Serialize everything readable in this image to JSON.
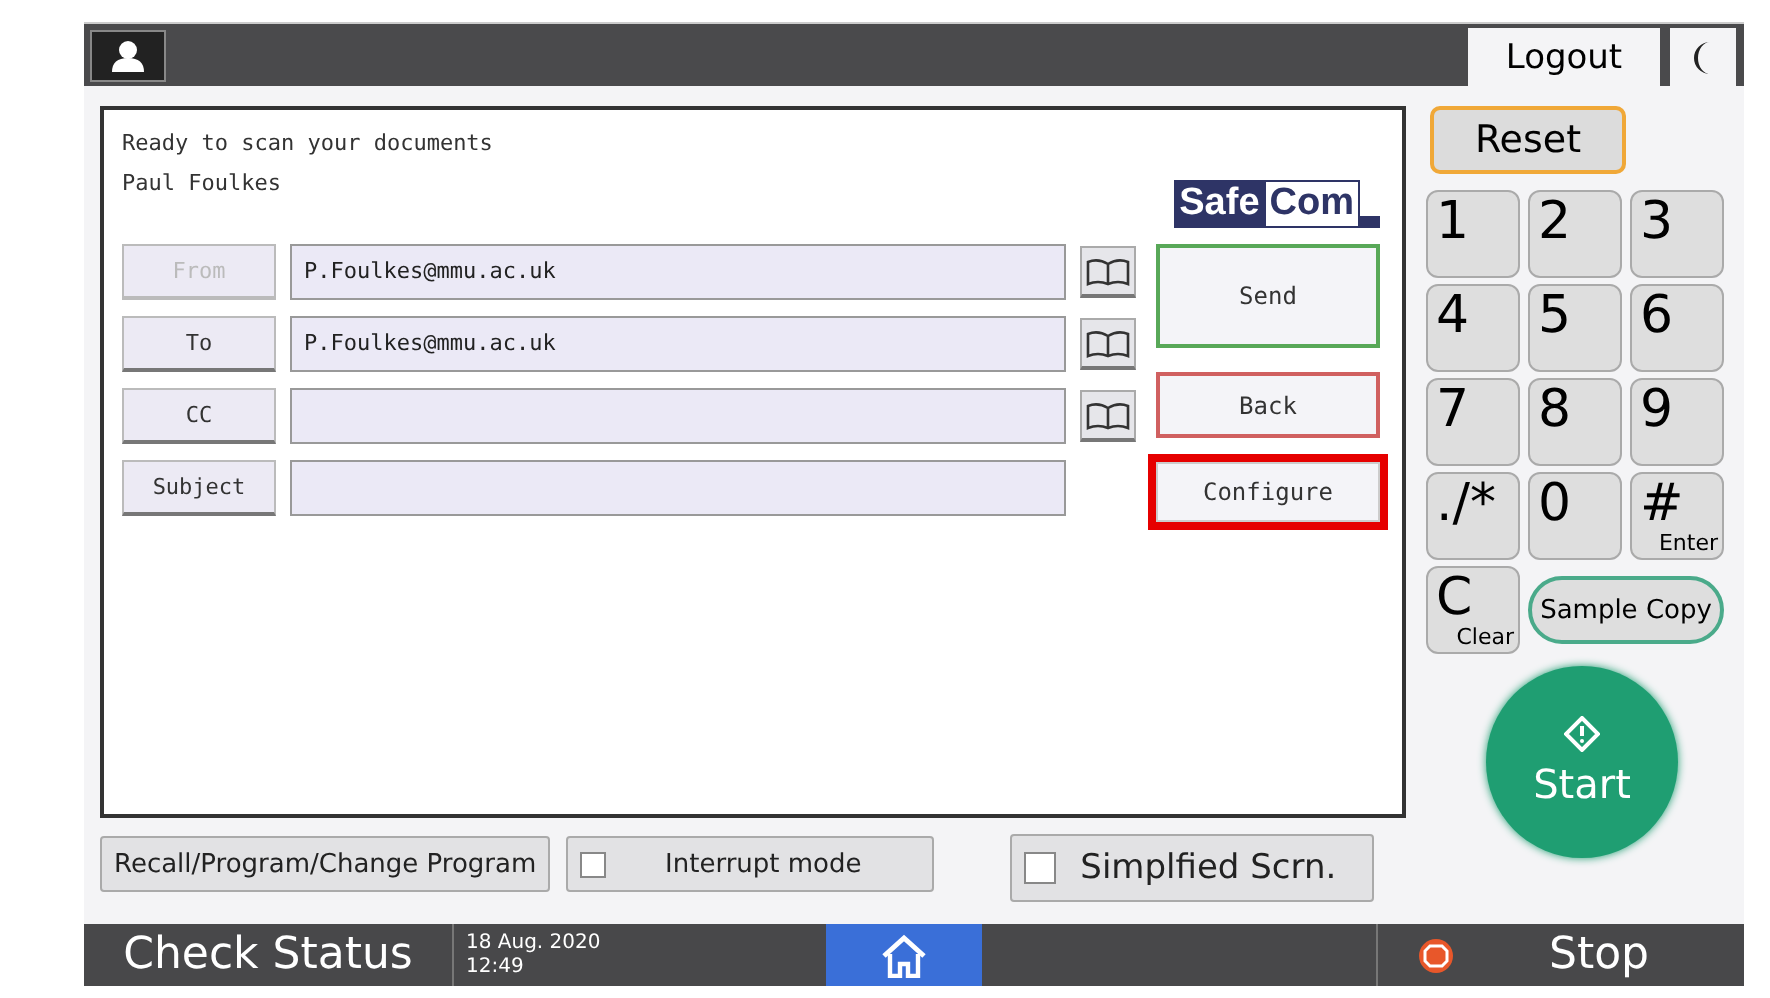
{
  "top_bar": {
    "logout": "Logout"
  },
  "message": [
    "Ready to scan your documents",
    "Paul Foulkes"
  ],
  "logo": {
    "part_1": "Safe",
    "part_2": "Com"
  },
  "fields": [
    {
      "label": "From",
      "disabled": true,
      "value": "P.Foulkes@mmu.ac.uk",
      "address_book": true
    },
    {
      "label": "To",
      "disabled": false,
      "value": "P.Foulkes@mmu.ac.uk",
      "address_book": true
    },
    {
      "label": "CC",
      "disabled": false,
      "address_book": true
    },
    {
      "label": "Subject",
      "disabled": false,
      "address_book": false
    }
  ],
  "actions": [
    {
      "label": "Send",
      "kind": "send",
      "highlighted": false
    },
    {
      "label": "Back",
      "kind": "back",
      "highlighted": false
    },
    {
      "label": "Configure",
      "kind": "configure",
      "highlighted": true
    }
  ],
  "reset": "Reset",
  "keypad": [
    {
      "label": "1"
    },
    {
      "label": "2"
    },
    {
      "label": "3"
    },
    {
      "label": "4"
    },
    {
      "label": "5"
    },
    {
      "label": "6"
    },
    {
      "label": "7"
    },
    {
      "label": "8"
    },
    {
      "label": "9"
    },
    {
      "label": "./*"
    },
    {
      "label": "0"
    },
    {
      "label": "#",
      "sub": "Enter"
    },
    {
      "label": "C",
      "sub": "Clear"
    }
  ],
  "sample_copy": "Sample Copy",
  "start": "Start",
  "bottom_buttons": [
    {
      "label": "Recall/Program/Change Program",
      "kind": "button"
    },
    {
      "label": "Interrupt mode",
      "kind": "checkbox",
      "checked": false
    },
    {
      "label": "Simplfied Scrn.",
      "kind": "large_checkbox",
      "checked": false
    }
  ],
  "status_bar": {
    "check_status": "Check Status",
    "date": "18 Aug. 2020",
    "time": "12:49",
    "stop": "Stop"
  }
}
